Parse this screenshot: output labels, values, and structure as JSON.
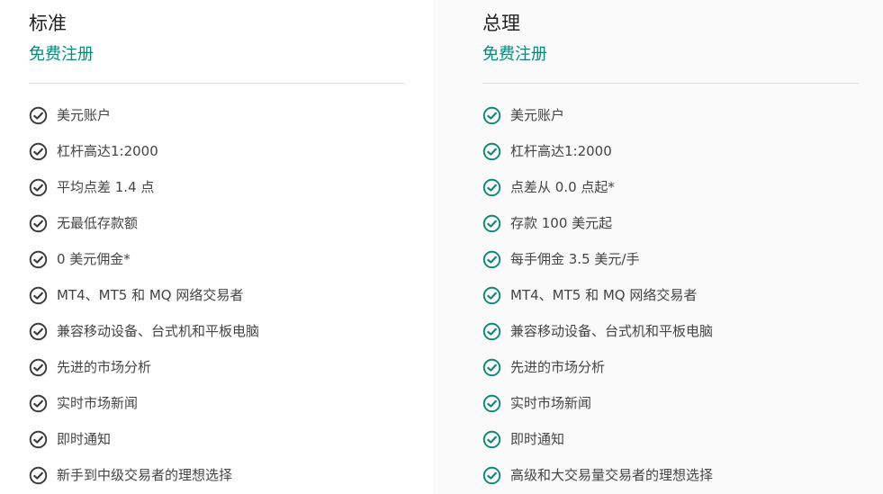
{
  "colors": {
    "accent": "#0b8a7a",
    "standard_check": "#3a3a3a",
    "raw_check": "#0b8a7a",
    "divider": "#dddddd",
    "raw_panel_bg": "#fafafa"
  },
  "icons": {
    "feature_check": "check-circle-icon"
  },
  "plans": [
    {
      "title": "标准",
      "signup_label": "免费注册",
      "features": [
        "美元账户",
        "杠杆高达1:2000",
        "平均点差 1.4 点",
        "无最低存款额",
        "0 美元佣金*",
        "MT4、MT5 和 MQ 网络交易者",
        "兼容移动设备、台式机和平板电脑",
        "先进的市场分析",
        "实时市场新闻",
        "即时通知",
        "新手到中级交易者的理想选择"
      ]
    },
    {
      "title": "总理",
      "signup_label": "免费注册",
      "features": [
        "美元账户",
        "杠杆高达1:2000",
        "点差从 0.0 点起*",
        "存款 100 美元起",
        "每手佣金 3.5 美元/手",
        "MT4、MT5 和 MQ 网络交易者",
        "兼容移动设备、台式机和平板电脑",
        "先进的市场分析",
        "实时市场新闻",
        "即时通知",
        "高级和大交易量交易者的理想选择"
      ]
    }
  ]
}
